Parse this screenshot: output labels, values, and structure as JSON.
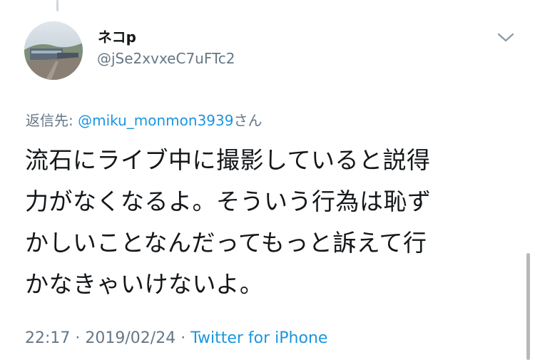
{
  "tweet": {
    "display_name": "ネコp",
    "handle": "@jSe2xvxeC7uFTc2",
    "reply_label": "返信先: ",
    "reply_mention": "@miku_monmon3939",
    "reply_suffix": "さん",
    "text_lines": [
      "流石にライブ中に撮影していると説得",
      "力がなくなるよ。そういう行為は恥ず",
      "かしいことなんだってもっと訴えて行",
      "かなきゃいけないよ。"
    ],
    "time": "22:17",
    "date": "2019/02/24",
    "separator": " · ",
    "source": "Twitter for iPhone"
  },
  "icons": {
    "avatar": "profile-photo",
    "menu": "chevron-down-icon"
  },
  "colors": {
    "link": "#1b95e0",
    "secondary_text": "#657786",
    "primary_text": "#14171a"
  }
}
